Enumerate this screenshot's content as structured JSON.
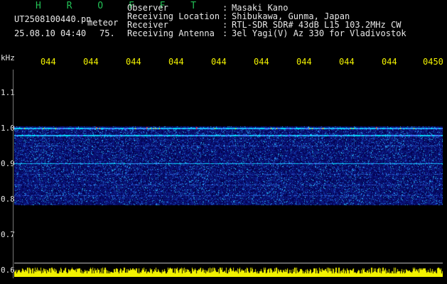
{
  "header": {
    "brand": "H R O F F T",
    "filename": "UT2508100440.pn",
    "meteor_label": "meteor",
    "datetime": "25.08.10 04:40",
    "sample_number": "75.",
    "info": [
      {
        "label": "Observer",
        "sep": ":",
        "value": "Masaki Kano"
      },
      {
        "label": "Receiving Location",
        "sep": ":",
        "value": "Shibukawa, Gunma, Japan"
      },
      {
        "label": "Receiver",
        "sep": ":",
        "value": "RTL-SDR SDR# 43dB L15 103.2MHz CW"
      },
      {
        "label": "Receiving Antenna",
        "sep": ":",
        "value": "3el Yagi(V) Az 330 for Vladivostok"
      }
    ]
  },
  "axes": {
    "y_unit": "kHz",
    "y_ticks": [
      "1.1",
      "1.0",
      "0.9",
      "0.8",
      "0.7",
      "0.6"
    ],
    "x_ticks": [
      "044",
      "044",
      "044",
      "044",
      "044",
      "044",
      "044",
      "044",
      "044",
      "0450"
    ]
  },
  "display": {
    "spectrogram_band_khz": [
      0.785,
      1.005
    ],
    "strong_lines_khz": [
      1.0,
      0.98,
      0.9
    ],
    "colors": {
      "background": "#000000",
      "time_ticks": "#f2f200",
      "brand": "#22c055",
      "noise": "#1424a0",
      "signal": "#00e6ff",
      "peak": "#ff3030",
      "power_bar": "#f2f200"
    }
  }
}
